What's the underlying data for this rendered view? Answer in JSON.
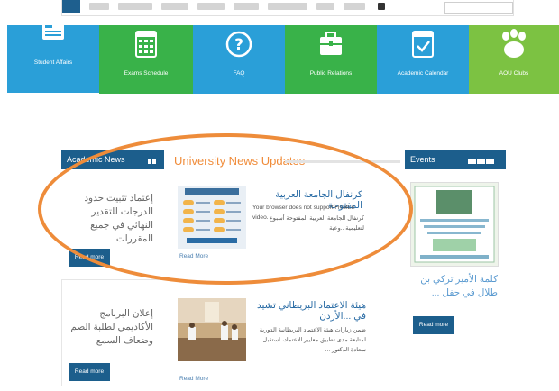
{
  "tiles": [
    {
      "label": "Student Affairs",
      "icon": "id-card-icon",
      "color": "#2a9fd8"
    },
    {
      "label": "Exams Schedule",
      "icon": "calendar-icon",
      "color": "#39b249"
    },
    {
      "label": "FAQ",
      "icon": "question-icon",
      "color": "#2a9fd8"
    },
    {
      "label": "Public Relations",
      "icon": "briefcase-icon",
      "color": "#39b249"
    },
    {
      "label": "Academic Calendar",
      "icon": "calendar-check-icon",
      "color": "#2a9fd8"
    },
    {
      "label": "AOU Clubs",
      "icon": "paw-icon",
      "color": "#7cc242"
    }
  ],
  "academic_news": {
    "title": "Academic News",
    "items": [
      {
        "text": "إعتماد تثبيت حدود الدرجات للتقدير النهائي في جميع المقررات",
        "button": "Read more"
      },
      {
        "text": "إعلان البرنامج الأكاديمي لطلبة الصم وضعاف السمع",
        "button": "Read more"
      }
    ]
  },
  "university_news": {
    "title": "University News Updates",
    "articles": [
      {
        "headline": "كرنفال الجامعة العربية المفتوحة",
        "body_en": "Your browser does not support HTML5 video.",
        "body_ar": "كرنفال الجامعة العربية المفتوحة أسبوع لتعليمية ..وعية",
        "read_more": "Read More"
      },
      {
        "headline": "هيئة الاعتماد البريطاني تشيد في ...الأردن",
        "body_ar": "ضمن زيارات هيئة الاعتماد البريطانية الدورية لمتابعة مدى تطبيق معايير الاعتماد، استقبل سعادة الدكتور ...",
        "read_more": "Read More"
      }
    ]
  },
  "events": {
    "title": "Events",
    "item": {
      "text": "كلمة الأمير تركي بن طلال في حفل ...",
      "button": "Read more"
    }
  },
  "colors": {
    "nav_blue": "#1c5e8c",
    "highlight_oval": "#ee8c3a",
    "news_title": "#f08c3a"
  }
}
